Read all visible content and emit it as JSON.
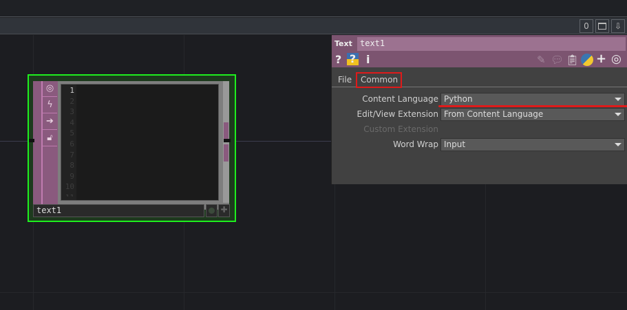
{
  "toolbar": {
    "counter": "0",
    "window_icon": "window-icon",
    "down_icon": "download-arrow-icon"
  },
  "panel": {
    "op_type": "Text",
    "op_name": "text1",
    "icons": {
      "help": "?",
      "python_help": "?",
      "info": "i"
    },
    "tabs": [
      {
        "label": "File"
      },
      {
        "label": "Common",
        "active": true
      }
    ],
    "params": [
      {
        "label": "Content Language",
        "value": "Python"
      },
      {
        "label": "Edit/View Extension",
        "value": "From Content Language"
      },
      {
        "label": "Custom Extension",
        "disabled": true
      },
      {
        "label": "Word Wrap",
        "value": "Input"
      }
    ]
  },
  "node": {
    "name": "text1",
    "line_numbers": [
      "1",
      "2",
      "3",
      "4",
      "5",
      "6",
      "7",
      "8",
      "9",
      "10",
      "11"
    ]
  },
  "colors": {
    "selection": "#1ef01e",
    "op_family": "#7c5470",
    "annotation": "#e01a1a"
  }
}
